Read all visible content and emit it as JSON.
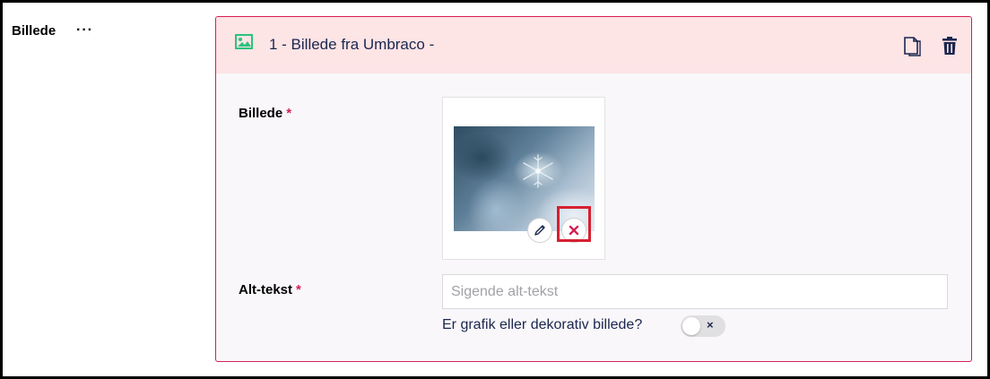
{
  "property": {
    "label": "Billede",
    "actions_label": "···"
  },
  "block": {
    "icon": "picture-icon",
    "title": "1 - Billede fra Umbraco -",
    "copy_icon": "copy-icon",
    "delete_icon": "trash-icon",
    "accent_color": "#d42054",
    "header_bg": "#fde4e5"
  },
  "image_field": {
    "label": "Billede",
    "required_mark": "*",
    "edit_icon": "pencil-icon",
    "remove_icon": "close-icon"
  },
  "alt_field": {
    "label": "Alt-tekst",
    "required_mark": "*",
    "value": "",
    "placeholder": "Sigende alt-tekst"
  },
  "decorative_toggle": {
    "label": "Er grafik eller dekorativ billede?",
    "state": "off",
    "off_glyph": "×"
  }
}
